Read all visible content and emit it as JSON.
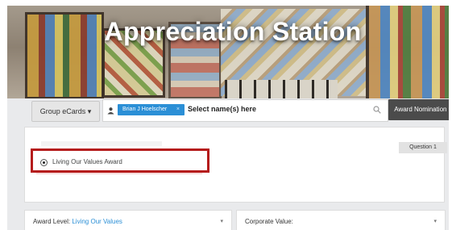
{
  "header": {
    "title": "Appreciation Station"
  },
  "toolbar": {
    "group_ecards": "Group eCards ▾",
    "selected_recipient": "Brian J Hoelscher",
    "chip_remove": "×",
    "search_placeholder": "Select name(s) here",
    "award_nomination": "Award Nomination ▾"
  },
  "question": {
    "tab_label": "Question 1",
    "option_label": "Living Our Values Award"
  },
  "fields": {
    "award_level_label": "Award Level:",
    "award_level_value": "Living Our Values",
    "corporate_value_label": "Corporate Value:",
    "caret": "▾"
  },
  "icons": [
    "user-icon",
    "search-icon",
    "chevron-down-icon"
  ],
  "colors": {
    "accent": "#2b8fd6",
    "highlight_border": "#b51c1c",
    "dark_button": "#4b4b4b"
  }
}
